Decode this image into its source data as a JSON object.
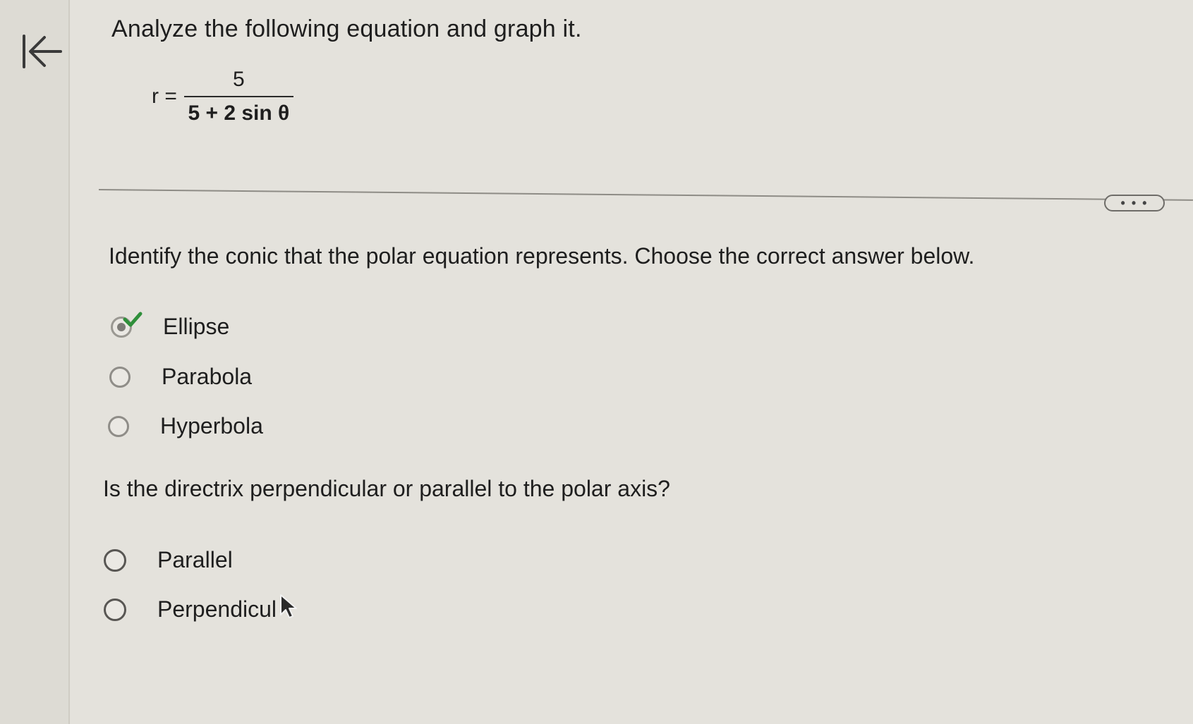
{
  "problem": {
    "title": "Analyze the following equation and graph it.",
    "equation": {
      "lhs": "r =",
      "numerator": "5",
      "denominator": "5 + 2 sin θ"
    }
  },
  "more_button_label": "• • •",
  "questions": [
    {
      "prompt": "Identify the conic that the polar equation represents. Choose the correct answer below.",
      "options": [
        {
          "label": "Ellipse",
          "selected": true,
          "correct": true
        },
        {
          "label": "Parabola",
          "selected": false
        },
        {
          "label": "Hyperbola",
          "selected": false
        }
      ]
    },
    {
      "prompt": "Is the directrix perpendicular or parallel to the polar axis?",
      "options": [
        {
          "label": "Parallel",
          "selected": false
        },
        {
          "label": "Perpendicul",
          "selected": false
        }
      ]
    }
  ],
  "colors": {
    "background": "#e4e2dc",
    "left_rail": "#dddbd4",
    "check_mark": "#2f8f3a"
  }
}
